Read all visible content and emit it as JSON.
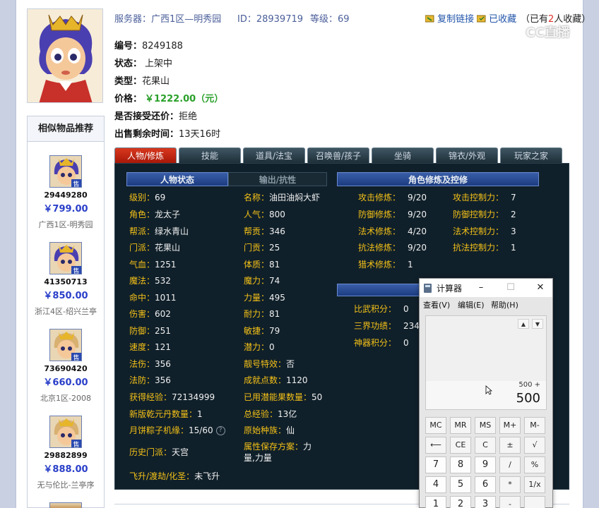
{
  "header": {
    "server": "服务器：广西1区—明秀园",
    "id": "ID：28939719",
    "level": "等级：69",
    "copy_link": "复制链接",
    "favorited": "已收藏",
    "fav_prefix": "（已有",
    "fav_count": "2",
    "fav_suffix": "人收藏）",
    "watermark": "CC直播"
  },
  "item": {
    "number_label": "编号：",
    "number": "8249188",
    "status_label": "状态：",
    "status": "上架中",
    "type_label": "类型：",
    "type": "花果山",
    "price_label": "价格：",
    "price": "￥1222.00（元）",
    "counter_label": "是否接受还价：",
    "counter": "拒绝",
    "remaining_label": "出售剩余时间：",
    "remaining": "13天16时"
  },
  "sidebar": {
    "title": "相似物品推荐",
    "items": [
      {
        "id": "29449280",
        "price": "￥799.00",
        "server": "广西1区-明秀园"
      },
      {
        "id": "41350713",
        "price": "￥850.00",
        "server": "浙江4区-绍兴兰亭"
      },
      {
        "id": "73690420",
        "price": "￥660.00",
        "server": "北京1区-2008"
      },
      {
        "id": "29882899",
        "price": "￥888.00",
        "server": "无与伦比-兰亭序"
      }
    ],
    "badge": "售"
  },
  "tabs": [
    "人物/修炼",
    "技能",
    "道具/法宝",
    "召唤兽/孩子",
    "坐骑",
    "锦衣/外观",
    "玩家之家"
  ],
  "panel": {
    "sub_a": "人物状态",
    "sub_b": "输出/抗性",
    "sub_c": "角色修炼及控修",
    "col1": [
      {
        "l": "级别：",
        "v": "69"
      },
      {
        "l": "角色：",
        "v": "龙太子"
      },
      {
        "l": "帮派：",
        "v": "绿水青山"
      },
      {
        "l": "门派：",
        "v": "花果山"
      },
      {
        "l": "气血：",
        "v": "1251"
      },
      {
        "l": "魔法：",
        "v": "532"
      },
      {
        "l": "命中：",
        "v": "1011"
      },
      {
        "l": "伤害：",
        "v": "602"
      },
      {
        "l": "防御：",
        "v": "251"
      },
      {
        "l": "速度：",
        "v": "121"
      },
      {
        "l": "法伤：",
        "v": "356"
      },
      {
        "l": "法防：",
        "v": "356"
      },
      {
        "l": "获得经验：",
        "v": "72134999"
      },
      {
        "l": "新版乾元丹数量：",
        "v": "1"
      },
      {
        "l": "月饼粽子机缘：",
        "v": "15/60"
      },
      {
        "l": "历史门派：",
        "v": "天宫"
      },
      {
        "l": "飞升/渡劫/化圣：",
        "v": "未飞升"
      }
    ],
    "col2": [
      {
        "l": "名称：",
        "v": "油田油焖大虾"
      },
      {
        "l": "人气：",
        "v": "800"
      },
      {
        "l": "帮贡：",
        "v": "346"
      },
      {
        "l": "门贡：",
        "v": "25"
      },
      {
        "l": "体质：",
        "v": "81"
      },
      {
        "l": "魔力：",
        "v": "74"
      },
      {
        "l": "力量：",
        "v": "495"
      },
      {
        "l": "耐力：",
        "v": "81"
      },
      {
        "l": "敏捷：",
        "v": "79"
      },
      {
        "l": "潜力：",
        "v": "0"
      },
      {
        "l": "靓号特效：",
        "v": "否"
      },
      {
        "l": "成就点数：",
        "v": "1120"
      },
      {
        "l": "已用潜能果数量：",
        "v": "50"
      },
      {
        "l": "总经验：",
        "v": "13亿"
      },
      {
        "l": "原始种族：",
        "v": "仙"
      },
      {
        "l": "属性保存方案：",
        "v": "力量,力量"
      }
    ],
    "col3": [
      {
        "l": "攻击修炼：",
        "v": "9/20"
      },
      {
        "l": "防御修炼：",
        "v": "9/20"
      },
      {
        "l": "法术修炼：",
        "v": "4/20"
      },
      {
        "l": "抗法修炼：",
        "v": "9/20"
      },
      {
        "l": "猎术修炼：",
        "v": "1"
      }
    ],
    "col4": [
      {
        "l": "攻击控制力：",
        "v": "7"
      },
      {
        "l": "防御控制力：",
        "v": "2"
      },
      {
        "l": "法术控制力：",
        "v": "3"
      },
      {
        "l": "抗法控制力：",
        "v": "1"
      }
    ],
    "col5": [
      {
        "l": "比武积分：",
        "v": "0"
      },
      {
        "l": "三界功绩：",
        "v": "234"
      },
      {
        "l": "神器积分：",
        "v": "0"
      }
    ]
  },
  "calculator": {
    "title": "计算器",
    "menu": [
      "查看(V)",
      "编辑(E)",
      "帮助(H)"
    ],
    "expression": "500 +",
    "result": "500",
    "keys": [
      [
        "MC",
        "MR",
        "MS",
        "M+",
        "M-"
      ],
      [
        "⟵",
        "CE",
        "C",
        "±",
        "√"
      ],
      [
        "7",
        "8",
        "9",
        "/",
        "%"
      ],
      [
        "4",
        "5",
        "6",
        "*",
        "1/x"
      ],
      [
        "1",
        "2",
        "3",
        "-",
        ""
      ]
    ]
  }
}
